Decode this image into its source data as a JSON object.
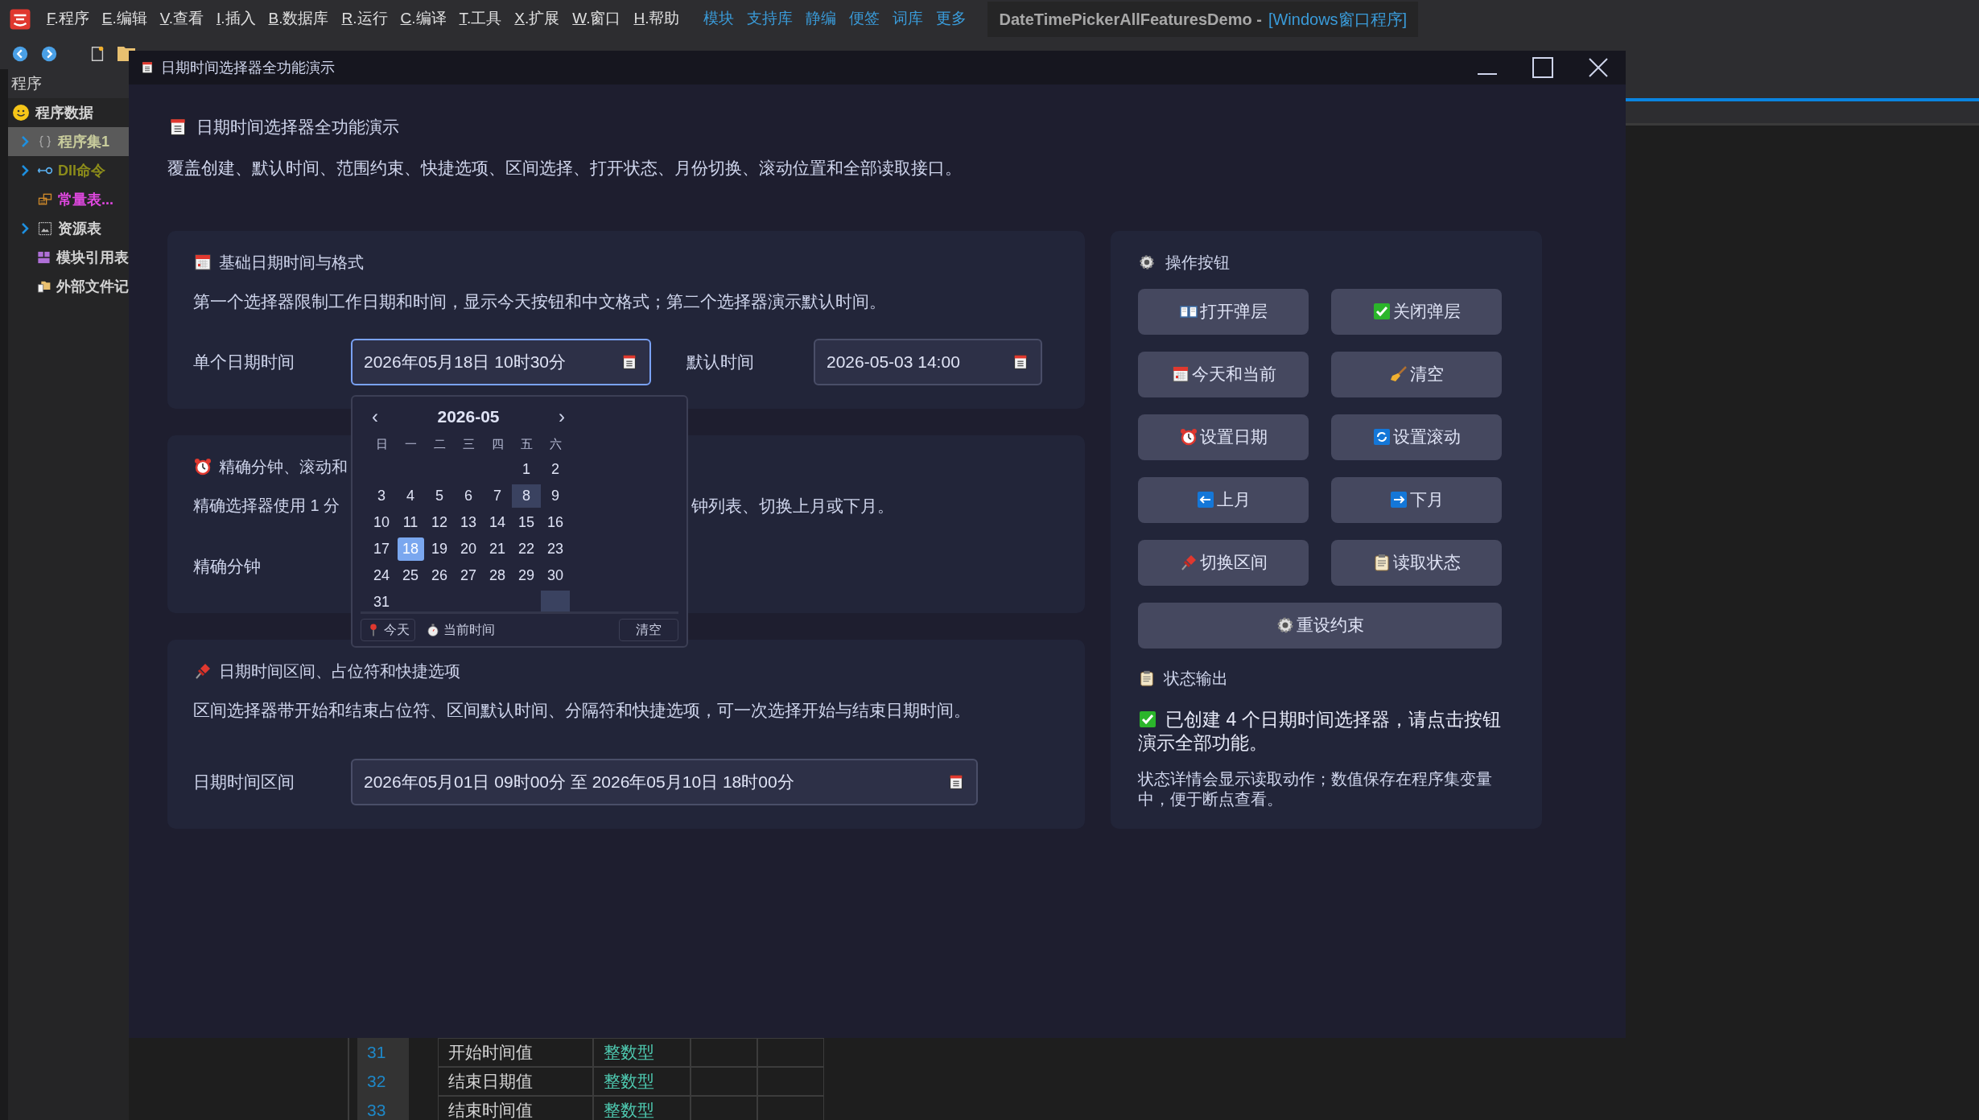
{
  "ide": {
    "menu": [
      {
        "label": "F.程序"
      },
      {
        "label": "E.编辑"
      },
      {
        "label": "V.查看"
      },
      {
        "label": "I.插入"
      },
      {
        "label": "B.数据库"
      },
      {
        "label": "R.运行"
      },
      {
        "label": "C.编译"
      },
      {
        "label": "T.工具"
      },
      {
        "label": "X.扩展"
      },
      {
        "label": "W.窗口"
      },
      {
        "label": "H.帮助"
      }
    ],
    "links": [
      "模块",
      "支持库",
      "静编",
      "便签",
      "词库",
      "更多"
    ],
    "project": "DateTimePickerAllFeaturesDemo -",
    "project_type": "[Windows窗口程序]",
    "sidebar": {
      "title": "程序",
      "items": [
        {
          "label": "程序数据",
          "color": "#d4d4d4",
          "children": [
            {
              "label": "程序集1",
              "expandable": true,
              "selected": true,
              "color": "#c8cc9c"
            },
            {
              "label": "Dll命令",
              "expandable": true,
              "selected": false,
              "color": "#8c8c1a"
            },
            {
              "label": "常量表...",
              "expandable": false,
              "selected": false,
              "color": "#e048e0"
            },
            {
              "label": "资源表",
              "expandable": true,
              "selected": false,
              "color": "#d4d4d4"
            },
            {
              "label": "模块引用表",
              "expandable": false,
              "selected": false,
              "color": "#d4d4d4"
            },
            {
              "label": "外部文件记",
              "expandable": false,
              "selected": false,
              "color": "#d4d4d4"
            }
          ]
        }
      ]
    },
    "table_rows": [
      {
        "number": "31",
        "name": "开始时间值",
        "type": "整数型"
      },
      {
        "number": "32",
        "name": "结束日期值",
        "type": "整数型"
      },
      {
        "number": "33",
        "name": "结束时间值",
        "type": "整数型"
      }
    ]
  },
  "dialog": {
    "title": "日期时间选择器全功能演示",
    "heading": "日期时间选择器全功能演示",
    "intro": "覆盖创建、默认时间、范围约束、快捷选项、区间选择、打开状态、月份切换、滚动位置和全部读取接口。",
    "sections": [
      {
        "kind": "full",
        "title": "基础日期时间与格式",
        "description": "第一个选择器限制工作日期和时间，显示今天按钮和中文格式；第二个选择器演示默认时间。",
        "fields": [
          {
            "kind": "single",
            "label": "单个日期时间",
            "value": "2026年05月18日 10时30分",
            "focused": true
          },
          {
            "kind": "short",
            "label": "默认时间",
            "value": "2026-05-03 14:00",
            "focused": false
          }
        ]
      },
      {
        "kind": "covered",
        "title": "精确分钟、滚动和",
        "description_start": "精确选择器使用 1 分",
        "description_end": "钟列表、切换上月或下月。",
        "fields": [
          {
            "kind": "hidden",
            "label": "精确分钟"
          }
        ]
      },
      {
        "kind": "full",
        "title": "日期时间区间、占位符和快捷选项",
        "description": "区间选择器带开始和结束占位符、区间默认时间、分隔符和快捷选项，可一次选择开始与结束日期时间。",
        "fields": [
          {
            "kind": "range",
            "label": "日期时间区间",
            "value": "2026年05月01日 09时00分 至 2026年05月10日 18时00分",
            "focused": false
          }
        ]
      }
    ],
    "popup": {
      "prev": "‹",
      "month": "2026-05",
      "next": "›",
      "weekdays": [
        "日",
        "一",
        "二",
        "三",
        "四",
        "五",
        "六"
      ],
      "weeks": [
        [
          {
            "kind": "blank"
          },
          {
            "kind": "blank"
          },
          {
            "kind": "blank"
          },
          {
            "kind": "blank"
          },
          {
            "kind": "blank"
          },
          {
            "kind": "day",
            "day": "1",
            "selected": false,
            "highlighted": false
          },
          {
            "kind": "day",
            "day": "2",
            "selected": false,
            "highlighted": false
          }
        ],
        [
          {
            "kind": "day",
            "day": "3",
            "selected": false,
            "highlighted": false
          },
          {
            "kind": "day",
            "day": "4",
            "selected": false,
            "highlighted": false
          },
          {
            "kind": "day",
            "day": "5",
            "selected": false,
            "highlighted": false
          },
          {
            "kind": "day",
            "day": "6",
            "selected": false,
            "highlighted": false
          },
          {
            "kind": "day",
            "day": "7",
            "selected": false,
            "highlighted": false
          },
          {
            "kind": "day",
            "day": "8",
            "selected": false,
            "highlighted": true
          },
          {
            "kind": "day",
            "day": "9",
            "selected": false,
            "highlighted": false
          }
        ],
        [
          {
            "kind": "day",
            "day": "10",
            "selected": false,
            "highlighted": false
          },
          {
            "kind": "day",
            "day": "11",
            "selected": false,
            "highlighted": false
          },
          {
            "kind": "day",
            "day": "12",
            "selected": false,
            "highlighted": false
          },
          {
            "kind": "day",
            "day": "13",
            "selected": false,
            "highlighted": false
          },
          {
            "kind": "day",
            "day": "14",
            "selected": false,
            "highlighted": false
          },
          {
            "kind": "day",
            "day": "15",
            "selected": false,
            "highlighted": false
          },
          {
            "kind": "day",
            "day": "16",
            "selected": false,
            "highlighted": false
          }
        ],
        [
          {
            "kind": "day",
            "day": "17",
            "selected": false,
            "highlighted": false
          },
          {
            "kind": "day",
            "day": "18",
            "selected": true,
            "highlighted": false
          },
          {
            "kind": "day",
            "day": "19",
            "selected": false,
            "highlighted": false
          },
          {
            "kind": "day",
            "day": "20",
            "selected": false,
            "highlighted": false
          },
          {
            "kind": "day",
            "day": "21",
            "selected": false,
            "highlighted": false
          },
          {
            "kind": "day",
            "day": "22",
            "selected": false,
            "highlighted": false
          },
          {
            "kind": "day",
            "day": "23",
            "selected": false,
            "highlighted": false
          }
        ],
        [
          {
            "kind": "day",
            "day": "24",
            "selected": false,
            "highlighted": false
          },
          {
            "kind": "day",
            "day": "25",
            "selected": false,
            "highlighted": false
          },
          {
            "kind": "day",
            "day": "26",
            "selected": false,
            "highlighted": false
          },
          {
            "kind": "day",
            "day": "27",
            "selected": false,
            "highlighted": false
          },
          {
            "kind": "day",
            "day": "28",
            "selected": false,
            "highlighted": false
          },
          {
            "kind": "day",
            "day": "29",
            "selected": false,
            "highlighted": false
          },
          {
            "kind": "day",
            "day": "30",
            "selected": false,
            "highlighted": false
          }
        ],
        [
          {
            "kind": "day",
            "day": "31",
            "selected": false,
            "highlighted": false
          },
          {
            "kind": "blank"
          },
          {
            "kind": "blank"
          },
          {
            "kind": "blank"
          },
          {
            "kind": "blank"
          },
          {
            "kind": "blank"
          },
          {
            "kind": "shaded"
          }
        ]
      ],
      "footer": [
        {
          "kind": "today",
          "label": "今天"
        },
        {
          "kind": "now",
          "label": "当前时间"
        },
        {
          "kind": "clear",
          "label": "清空"
        }
      ]
    },
    "actions": {
      "title": "操作按钮",
      "buttons": [
        {
          "label": "打开弹层",
          "wide": false
        },
        {
          "label": "关闭弹层",
          "wide": false
        },
        {
          "label": "今天和当前",
          "wide": false
        },
        {
          "label": "清空",
          "wide": false
        },
        {
          "label": "设置日期",
          "wide": false
        },
        {
          "label": "设置滚动",
          "wide": false
        },
        {
          "label": "上月",
          "wide": false
        },
        {
          "label": "下月",
          "wide": false
        },
        {
          "label": "切换区间",
          "wide": false
        },
        {
          "label": "读取状态",
          "wide": false
        },
        {
          "label": "重设约束",
          "wide": true
        }
      ]
    },
    "status": {
      "title": "状态输出",
      "message": "已创建 4 个日期时间选择器，请点击按钮演示全部功能。",
      "detail": "状态详情会显示读取动作；数值保存在程序集变量中，便于断点查看。"
    }
  }
}
